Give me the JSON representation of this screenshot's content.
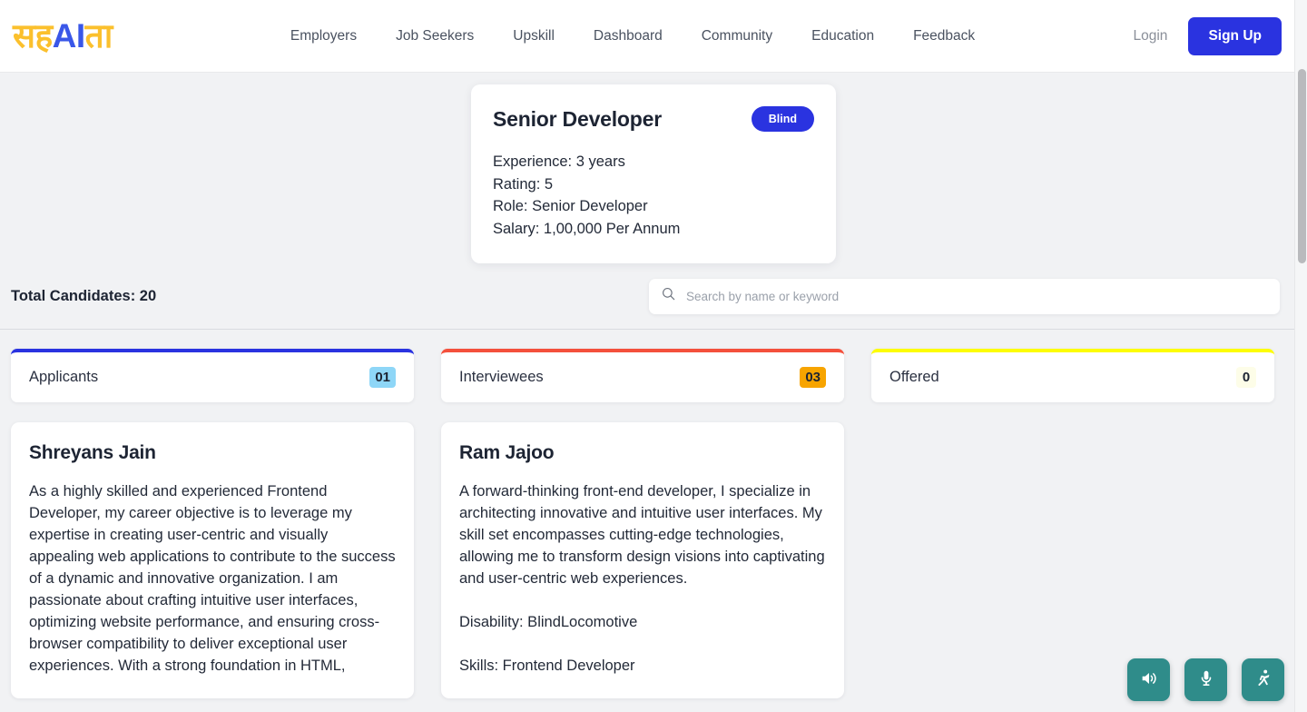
{
  "header": {
    "logo": {
      "part_a": "सह",
      "part_ai": "AI",
      "part_b": "ता"
    },
    "nav": [
      {
        "label": "Employers"
      },
      {
        "label": "Job Seekers"
      },
      {
        "label": "Upskill"
      },
      {
        "label": "Dashboard"
      },
      {
        "label": "Community"
      },
      {
        "label": "Education"
      },
      {
        "label": "Feedback"
      }
    ],
    "login_label": "Login",
    "signup_label": "Sign Up",
    "accent_color": "#2a33e0"
  },
  "job_card": {
    "title": "Senior Developer",
    "badge": "Blind",
    "experience": "Experience: 3 years",
    "rating": "Rating: 5",
    "role": "Role: Senior Developer",
    "salary": "Salary: 1,00,000 Per Annum"
  },
  "toolbar": {
    "total_candidates": "Total Candidates: 20",
    "search_placeholder": "Search by name or keyword",
    "search_value": "",
    "search_icon": "search-icon"
  },
  "columns": [
    {
      "title": "Applicants",
      "count": "01",
      "accent": "#2a33e0",
      "badge_bg": "#8ed6f7",
      "cards": [
        {
          "name": "Shreyans Jain",
          "bio": "As a highly skilled and experienced Frontend Developer, my career objective is to leverage my expertise in creating user-centric and visually appealing web applications to contribute to the success of a dynamic and innovative organization. I am passionate about crafting intuitive user interfaces, optimizing website performance, and ensuring cross-browser compatibility to deliver exceptional user experiences. With a strong foundation in HTML,"
        }
      ]
    },
    {
      "title": "Interviewees",
      "count": "03",
      "accent": "#f4503c",
      "badge_bg": "#f7a400",
      "cards": [
        {
          "name": "Ram Jajoo",
          "bio": "A forward-thinking front-end developer, I specialize in architecting innovative and intuitive user interfaces. My skill set encompasses cutting-edge technologies, allowing me to transform design visions into captivating and user-centric web experiences.",
          "disability": "Disability: BlindLocomotive",
          "skills": "Skills: Frontend Developer"
        }
      ]
    },
    {
      "title": "Offered",
      "count": "0",
      "accent": "#fdfd04",
      "badge_bg": "#fdfde8",
      "cards": []
    }
  ],
  "accessibility_toolbar": {
    "buttons": [
      {
        "name": "speaker-icon",
        "label": "Text to speech"
      },
      {
        "name": "microphone-icon",
        "label": "Voice input"
      },
      {
        "name": "accessibility-icon",
        "label": "Accessibility options"
      }
    ],
    "color": "#2f8c8a"
  }
}
